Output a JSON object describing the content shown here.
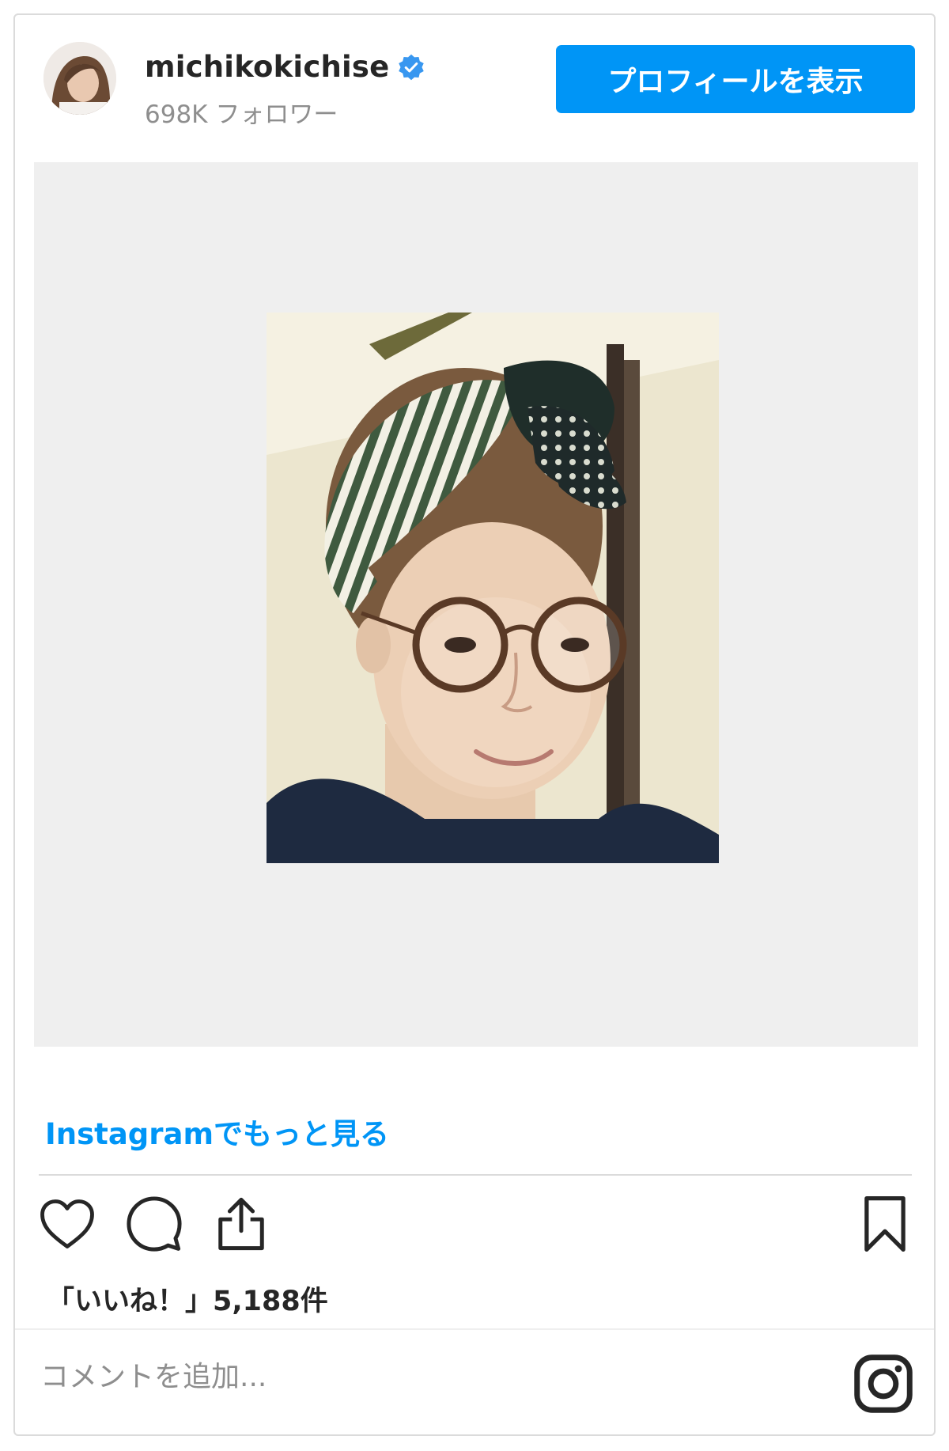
{
  "header": {
    "username": "michikokichise",
    "followers": "698K フォロワー",
    "profile_button": "プロフィールを表示"
  },
  "more_link": "Instagramでもっと見る",
  "likes": "「いいね！」5,188件",
  "comment_placeholder": "コメントを追加...",
  "icons": {
    "avatar": "profile-photo",
    "verified": "verified-badge-icon",
    "like": "heart-icon",
    "comment": "comment-bubble-icon",
    "share": "share-upload-icon",
    "save": "bookmark-icon",
    "logo": "instagram-logo-icon"
  },
  "colors": {
    "accent": "#0095f6",
    "text": "#262626",
    "muted": "#8e8e8e",
    "border": "#dbdbdb",
    "media_bg": "#efefef"
  }
}
